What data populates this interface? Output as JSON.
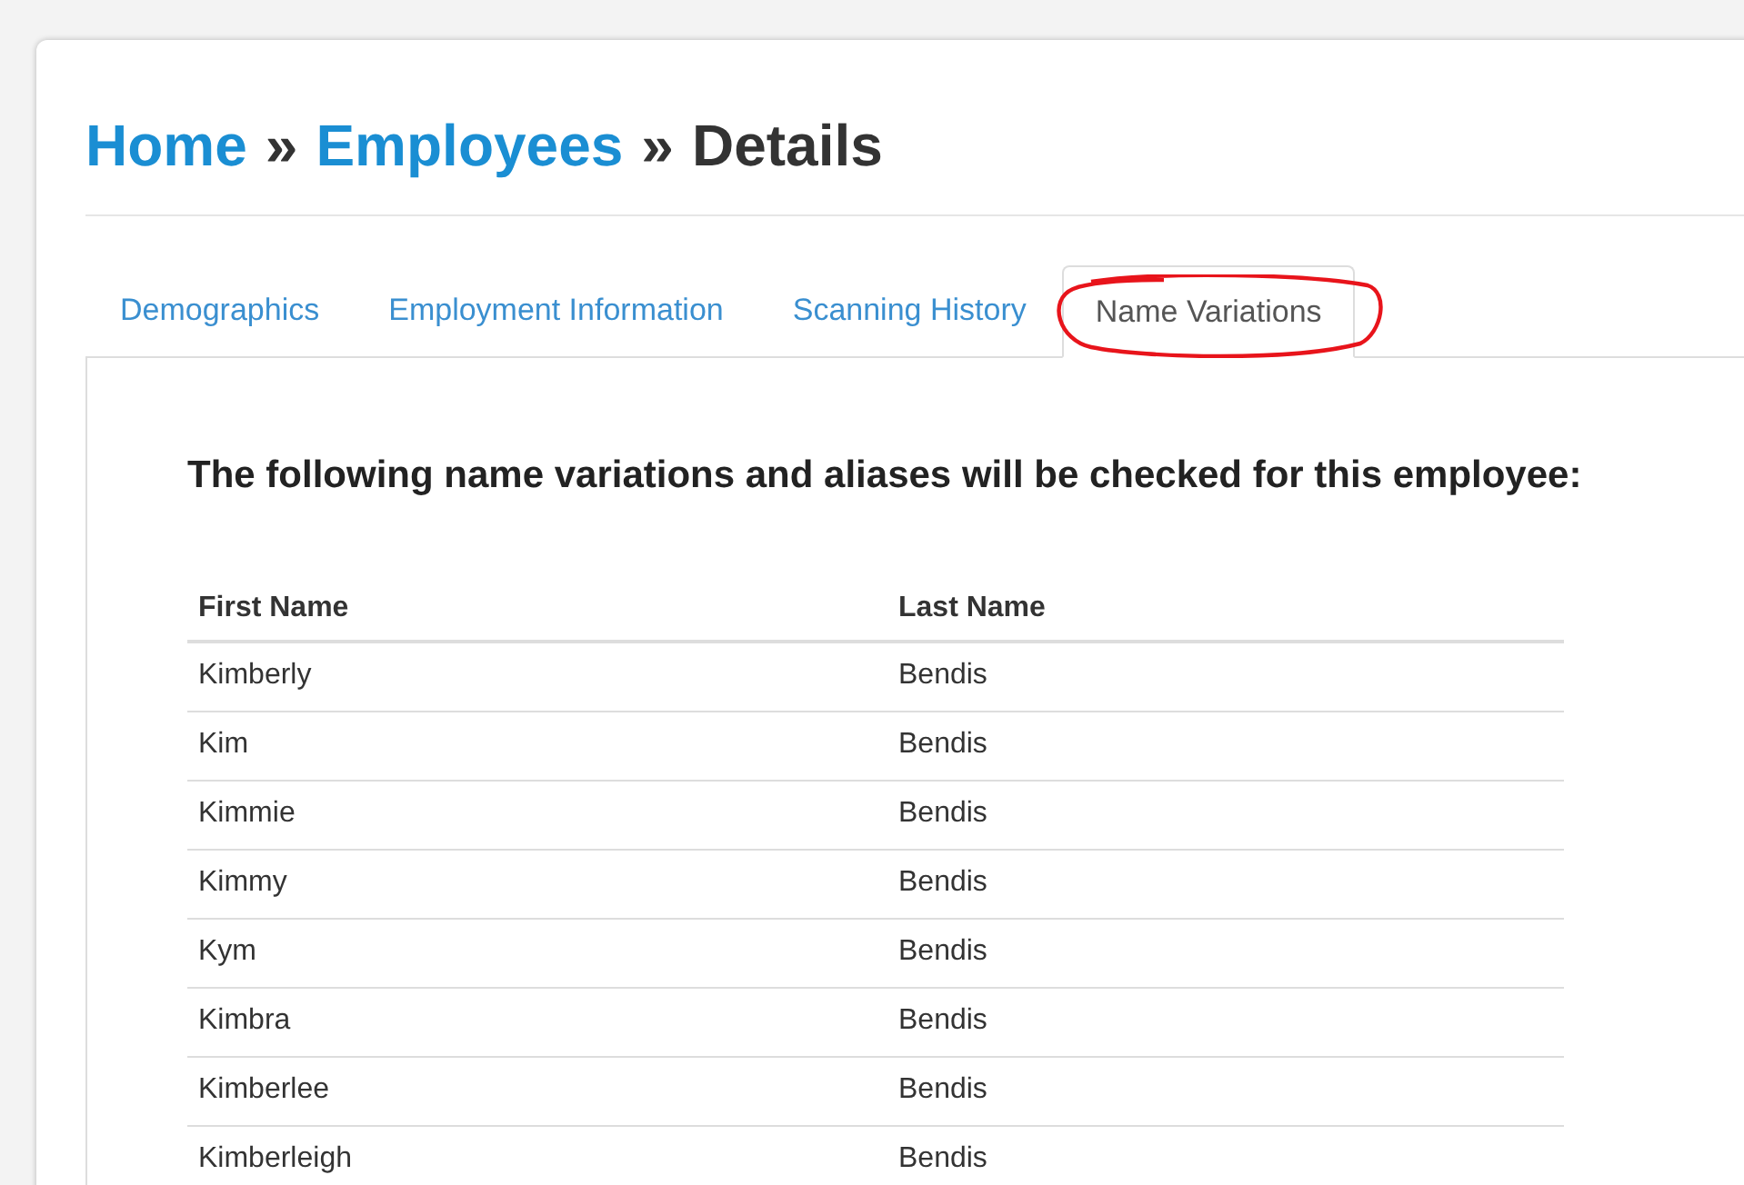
{
  "breadcrumb": [
    {
      "label": "Home",
      "kind": "link"
    },
    {
      "label": "Employees",
      "kind": "link"
    },
    {
      "label": "Details",
      "kind": "current"
    }
  ],
  "separator": "»",
  "tabs": [
    {
      "label": "Demographics",
      "selected": false
    },
    {
      "label": "Employment Information",
      "selected": false
    },
    {
      "label": "Scanning History",
      "selected": false
    },
    {
      "label": "Name Variations",
      "selected": true,
      "circled": true
    }
  ],
  "heading": "The following name variations and aliases will be checked for this employee:",
  "table": {
    "columns": [
      "First Name",
      "Last Name"
    ],
    "rows": [
      [
        "Kimberly",
        "Bendis"
      ],
      [
        "Kim",
        "Bendis"
      ],
      [
        "Kimmie",
        "Bendis"
      ],
      [
        "Kimmy",
        "Bendis"
      ],
      [
        "Kym",
        "Bendis"
      ],
      [
        "Kimbra",
        "Bendis"
      ],
      [
        "Kimberlee",
        "Bendis"
      ],
      [
        "Kimberleigh",
        "Bendis"
      ]
    ]
  }
}
